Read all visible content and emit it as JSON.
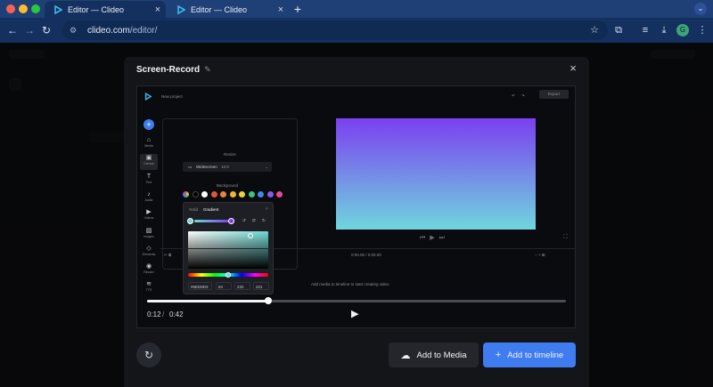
{
  "browser": {
    "tabs": [
      {
        "title": "Editor — Clideo",
        "active": true
      },
      {
        "title": "Editor — Clideo",
        "active": false
      }
    ],
    "url_host": "clideo.com",
    "url_path": "/editor/",
    "profile_initial": "G",
    "colors": {
      "tabstrip": "#1f3f77",
      "toolbar": "#13305f",
      "brand": "#3fb7e8"
    }
  },
  "modal": {
    "title": "Screen-Record",
    "video": {
      "project_name": "New project",
      "export_label": "Export",
      "sidebar": [
        "Media",
        "Canvas",
        "Text",
        "Audio",
        "Videos",
        "Images",
        "Elements",
        "Record",
        "TTS"
      ],
      "resize_label": "Resize",
      "resize_value": "Widescreen",
      "resize_ratio": "16:9",
      "background_label": "Background",
      "picker_tabs": [
        "Solid",
        "Gradient"
      ],
      "hex_value": "#6ED8D3",
      "rgb": [
        "94",
        "232",
        "221"
      ],
      "timecode": "0:00.00 / 0:00.00",
      "timeline_hint": "Add media to timeline to start creating video",
      "swatch_colors": [
        "#ffffff",
        "#000000",
        "#ffffff",
        "#e5533a",
        "#e8843a",
        "#f0b43a",
        "#e8d43a",
        "#3fc27a",
        "#3a8ce8",
        "#8a5ae8",
        "#e84a9a"
      ],
      "current_time": "0:12",
      "separator": "/",
      "duration": "0:42",
      "progress": 0.29
    },
    "actions": {
      "add_media_label": "Add to Media",
      "add_timeline_label": "Add to timeline"
    }
  }
}
